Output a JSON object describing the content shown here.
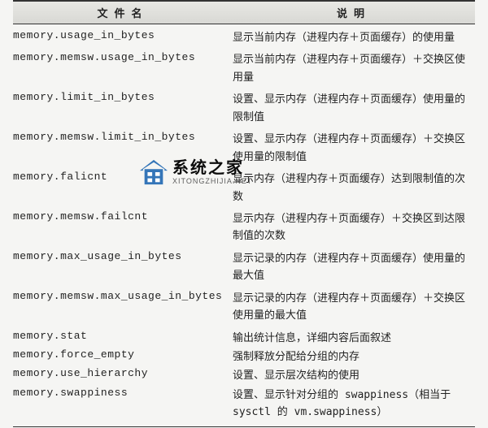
{
  "header": {
    "col1": "文件名",
    "col2": "说明"
  },
  "rows": [
    {
      "name": "memory.usage_in_bytes",
      "desc": "显示当前内存（进程内存＋页面缓存）的使用量"
    },
    {
      "name": "memory.memsw.usage_in_bytes",
      "desc": "显示当前内存（进程内存＋页面缓存）＋交换区使用量"
    },
    {
      "name": "memory.limit_in_bytes",
      "desc": "设置、显示内存（进程内存＋页面缓存）使用量的限制值"
    },
    {
      "name": "memory.memsw.limit_in_bytes",
      "desc": "设置、显示内存（进程内存＋页面缓存）＋交换区使用量的限制值"
    },
    {
      "name": "memory.falicnt",
      "desc": "显示内存（进程内存＋页面缓存）达到限制值的次数"
    },
    {
      "name": "memory.memsw.failcnt",
      "desc": "显示内存（进程内存＋页面缓存）＋交换区到达限制值的次数"
    },
    {
      "name": "memory.max_usage_in_bytes",
      "desc": "显示记录的内存（进程内存＋页面缓存）使用量的最大值"
    },
    {
      "name": "memory.memsw.max_usage_in_bytes",
      "desc": "显示记录的内存（进程内存＋页面缓存）＋交换区使用量的最大值"
    },
    {
      "name": "memory.stat",
      "desc": "输出统计信息，详细内容后面叙述"
    },
    {
      "name": "memory.force_empty",
      "desc": "强制释放分配给分组的内存"
    },
    {
      "name": "memory.use_hierarchy",
      "desc": "设置、显示层次结构的使用"
    },
    {
      "name": "memory.swappiness",
      "desc": "设置、显示针对分组的 swappiness（相当于 sysctl 的 vm.swappiness）"
    }
  ],
  "watermark": {
    "title": "系统之家",
    "url": "XITONGZHIJIA.NET"
  }
}
